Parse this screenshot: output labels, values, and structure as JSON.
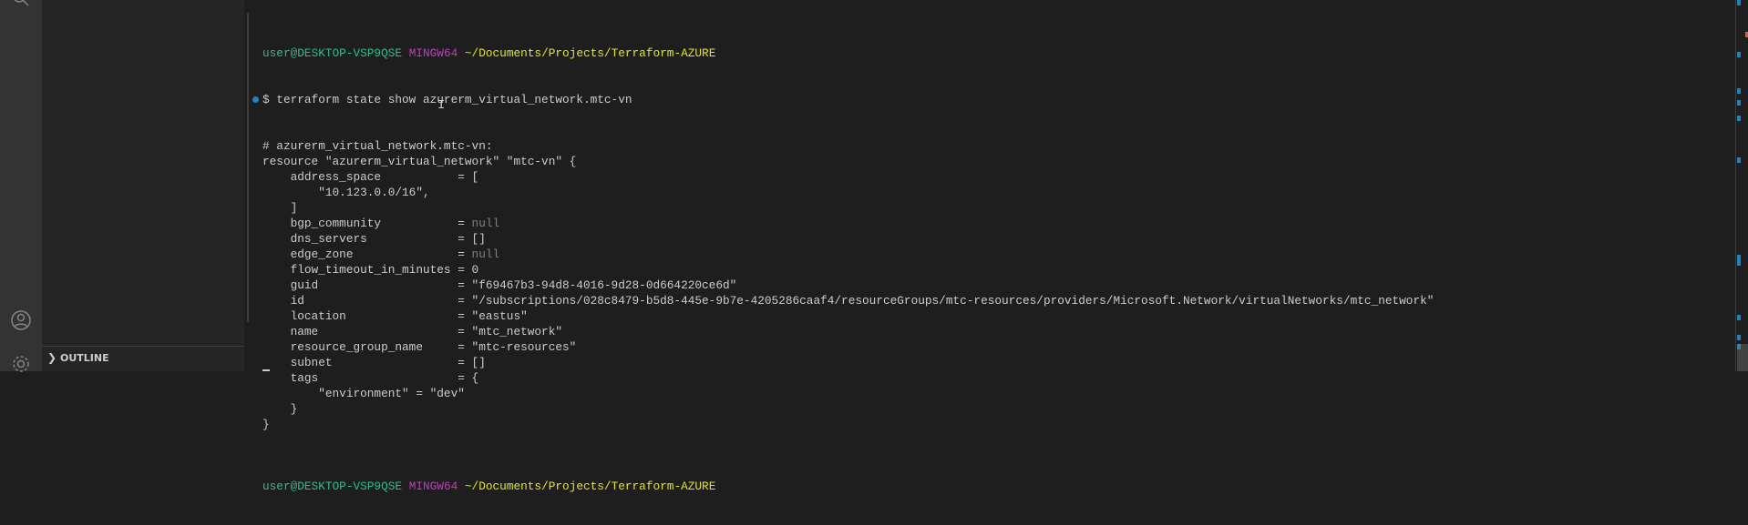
{
  "sidebar": {
    "outline_label": "OUTLINE"
  },
  "terminal": {
    "prompt_top": {
      "user": "user@DESKTOP-VSP9QSE",
      "shell": "MINGW64",
      "path": "~/Documents/Projects/Terraform-AZURE"
    },
    "command": "$ terraform state show azurerm_virtual_network.mtc-vn",
    "output": [
      {
        "text": "# azurerm_virtual_network.mtc-vn:"
      },
      {
        "text": "resource \"azurerm_virtual_network\" \"mtc-vn\" {"
      },
      {
        "text": "    address_space           = ["
      },
      {
        "text": "        \"10.123.0.0/16\","
      },
      {
        "text": "    ]"
      },
      {
        "text": "    bgp_community           = ",
        "null": "null"
      },
      {
        "text": "    dns_servers             = []"
      },
      {
        "text": "    edge_zone               = ",
        "null": "null"
      },
      {
        "text": "    flow_timeout_in_minutes = 0"
      },
      {
        "text": "    guid                    = \"f69467b3-94d8-4016-9d28-0d664220ce6d\""
      },
      {
        "text": "    id                      = \"/subscriptions/028c8479-b5d8-445e-9b7e-4205286caaf4/resourceGroups/mtc-resources/providers/Microsoft.Network/virtualNetworks/mtc_network\""
      },
      {
        "text": "    location                = \"eastus\""
      },
      {
        "text": "    name                    = \"mtc_network\""
      },
      {
        "text": "    resource_group_name     = \"mtc-resources\""
      },
      {
        "text": "    subnet                  = []"
      },
      {
        "text": "    tags                    = {"
      },
      {
        "text": "        \"environment\" = \"dev\""
      },
      {
        "text": "    }"
      },
      {
        "text": "}"
      },
      {
        "text": ""
      }
    ],
    "prompt_bottom": {
      "user": "user@DESKTOP-VSP9QSE",
      "shell": "MINGW64",
      "path": "~/Documents/Projects/Terraform-AZURE"
    }
  },
  "colors": {
    "accent": "#1a85c1",
    "prompt_user": "#23c189",
    "prompt_shell": "#bc3fbc",
    "prompt_path": "#e5e510",
    "error_mark": "#f14c4c"
  }
}
